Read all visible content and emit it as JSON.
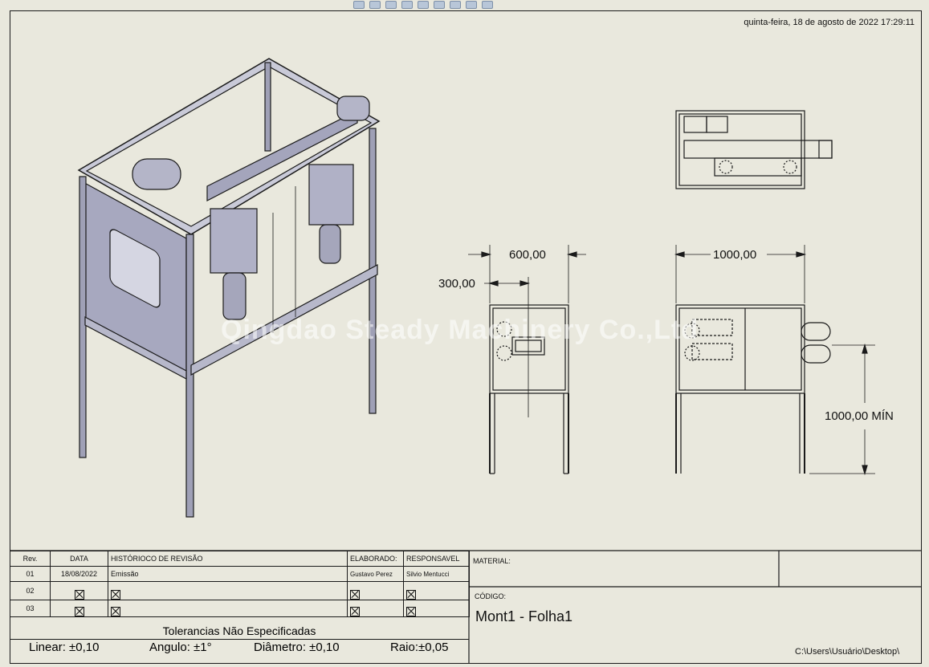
{
  "timestamp": "quinta-feira, 18 de agosto de 2022 17:29:11",
  "watermark": "Qingdao Steady Machinery Co.,Ltd",
  "dimensions": {
    "d600": "600,00",
    "d300": "300,00",
    "d1000w": "1000,00",
    "d1000h": "1000,00 MÍN"
  },
  "revision_table": {
    "headers": [
      "Rev.",
      "DATA",
      "HISTÓRIOCO DE REVISÃO",
      "ELABORADO:",
      "RESPONSAVEL"
    ],
    "rows": [
      {
        "rev": "01",
        "date": "18/08/2022",
        "history": "Emissão",
        "made_by": "Gustavo Perez",
        "responsible": "Silvio Mentucci"
      },
      {
        "rev": "02"
      },
      {
        "rev": "03"
      }
    ]
  },
  "material_label": "MATERIAL:",
  "codigo_label": "CÓDIGO:",
  "codigo_value": "Mont1 - Folha1",
  "file_path": "C:\\Users\\Usuário\\Desktop\\",
  "tolerances": {
    "title": "Tolerancias Não Especificadas",
    "linear": "Linear:  ±0,10",
    "angulo": "Angulo: ±1°",
    "diametro": "Diâmetro: ±0,10",
    "raio": "Raio:±0,05"
  }
}
